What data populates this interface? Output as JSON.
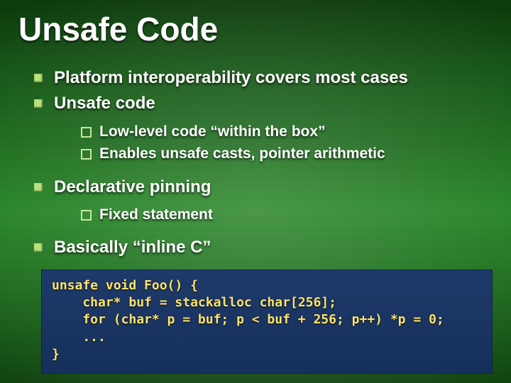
{
  "title": "Unsafe Code",
  "bullets": {
    "b1": "Platform interoperability covers most cases",
    "b2": "Unsafe code",
    "b2_sub": {
      "s1": "Low-level code “within the box”",
      "s2": "Enables unsafe casts, pointer arithmetic"
    },
    "b3": "Declarative pinning",
    "b3_sub": {
      "s1": "Fixed statement"
    },
    "b4": "Basically “inline C”"
  },
  "code": "unsafe void Foo() {\n    char* buf = stackalloc char[256];\n    for (char* p = buf; p < buf + 256; p++) *p = 0;\n    ...\n}"
}
